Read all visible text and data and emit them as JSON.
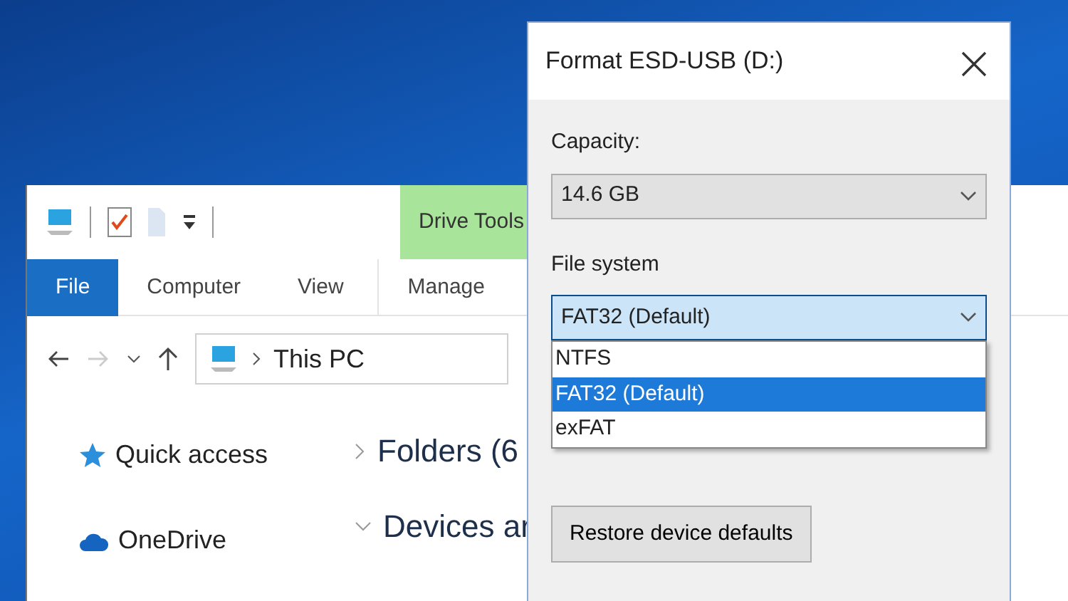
{
  "explorer": {
    "context_tab": "Drive Tools",
    "ribbon_tabs": [
      {
        "label": "File",
        "selected": true
      },
      {
        "label": "Computer",
        "selected": false
      },
      {
        "label": "View",
        "selected": false
      },
      {
        "label": "Manage",
        "selected": false
      }
    ],
    "address": "This PC",
    "nav_items": [
      {
        "label": "Quick access",
        "kind": "star"
      },
      {
        "label": "OneDrive",
        "kind": "cloud"
      }
    ],
    "groups": [
      {
        "label": "Folders (6",
        "expanded": false
      },
      {
        "label": "Devices ar",
        "expanded": true
      }
    ]
  },
  "dialog": {
    "title": "Format ESD-USB (D:)",
    "capacity_label": "Capacity:",
    "capacity_value": "14.6 GB",
    "file_system_label": "File system",
    "file_system_value": "FAT32 (Default)",
    "options": [
      {
        "label": "NTFS",
        "selected": false
      },
      {
        "label": "FAT32 (Default)",
        "selected": true
      },
      {
        "label": "exFAT",
        "selected": false
      }
    ],
    "restore_button": "Restore device defaults"
  }
}
